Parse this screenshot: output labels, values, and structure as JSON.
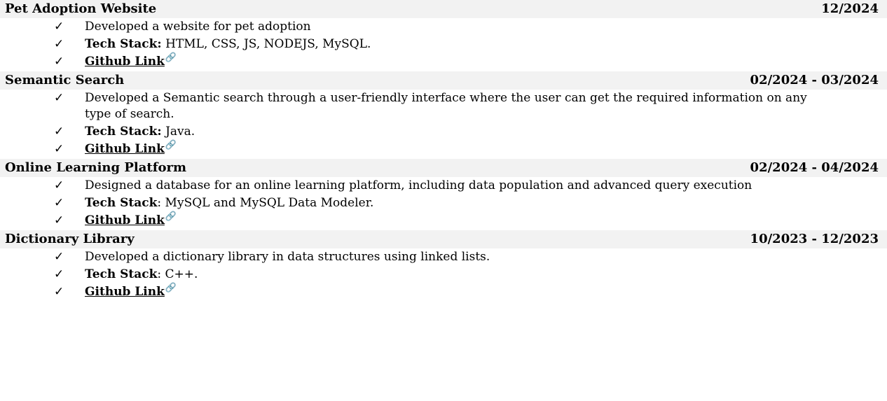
{
  "projects": [
    {
      "title": "Pet Adoption Website",
      "date": "12/2024",
      "description": "Developed a website for pet adoption",
      "tech_label": "Tech Stack:",
      "tech_value": " HTML, CSS, JS, NODEJS, MySQL.",
      "link_label": "Github Link"
    },
    {
      "title": "Semantic Search",
      "date": "02/2024 - 03/2024",
      "description": "Developed a Semantic search through a user-friendly interface where the user can get the required information on any type of search.",
      "tech_label": "Tech Stack:",
      "tech_value": " Java.",
      "link_label": "Github Link"
    },
    {
      "title": "Online Learning Platform",
      "date": "02/2024 - 04/2024",
      "description": "Designed a database for an online learning platform, including data population and advanced query execution",
      "tech_label": "Tech Stack",
      "tech_value": ": MySQL and MySQL Data Modeler.",
      "link_label": "Github Link"
    },
    {
      "title": "Dictionary Library",
      "date": "10/2023 - 12/2023",
      "description": "Developed a dictionary library in data structures using linked lists.",
      "tech_label": "Tech Stack",
      "tech_value": ": C++.",
      "link_label": "Github Link"
    }
  ],
  "icons": {
    "bullet": "checkmark-icon",
    "link": "link-icon"
  }
}
